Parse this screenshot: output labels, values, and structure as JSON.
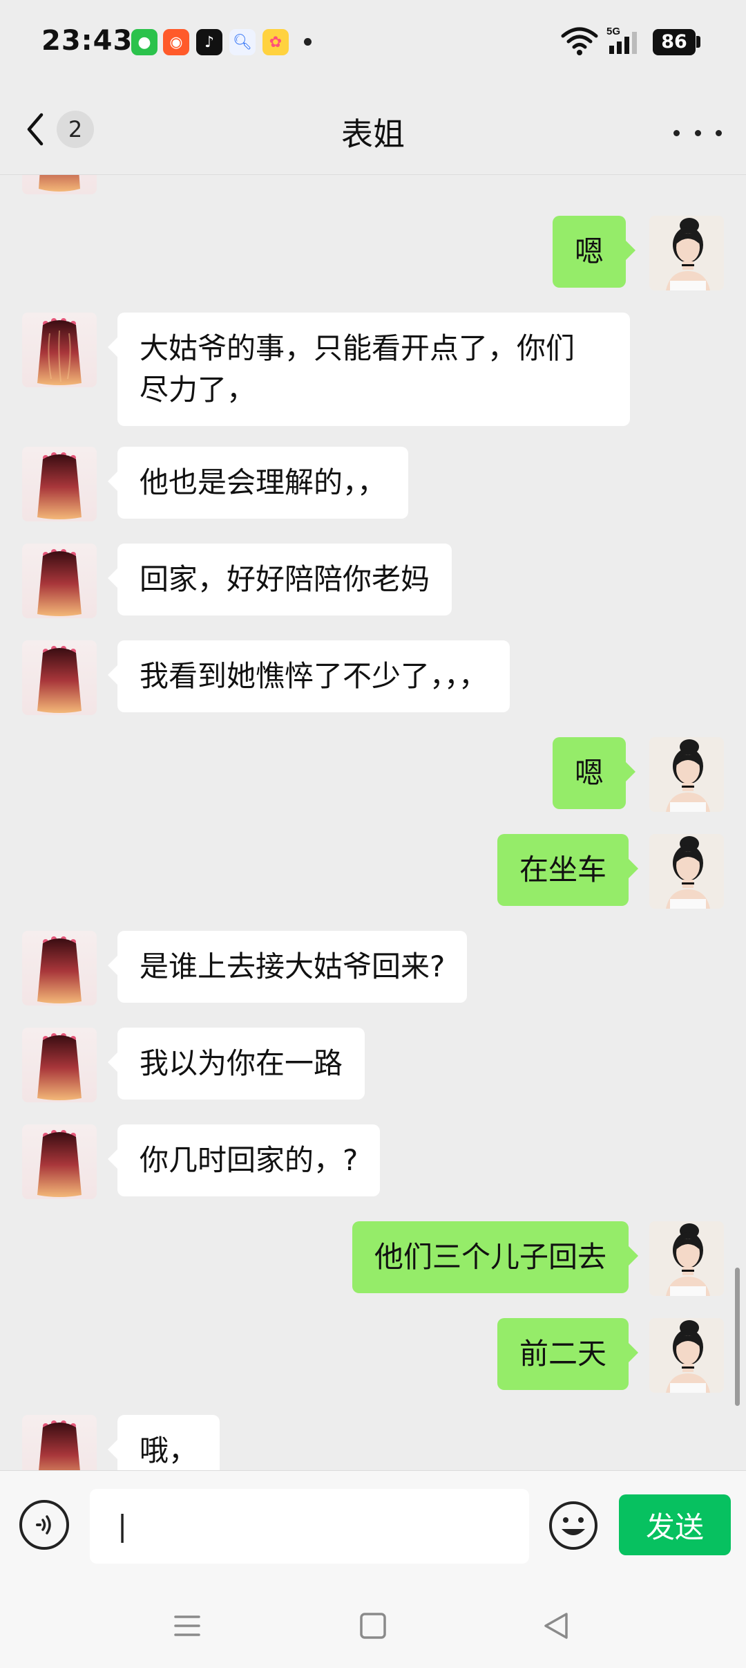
{
  "status_bar": {
    "time": "23:43",
    "battery": "86",
    "network": "5G"
  },
  "header": {
    "title": "表姐",
    "unread_count": "2"
  },
  "messages": [
    {
      "from": "other",
      "text": ""
    },
    {
      "from": "me",
      "text": "嗯"
    },
    {
      "from": "other",
      "text": "大姑爷的事，只能看开点了，你们\n尽力了，"
    },
    {
      "from": "other",
      "text": "他也是会理解的，，"
    },
    {
      "from": "other",
      "text": "回家，好好陪陪你老妈"
    },
    {
      "from": "other",
      "text": "我看到她憔悴了不少了，，，"
    },
    {
      "from": "me",
      "text": "嗯"
    },
    {
      "from": "me",
      "text": "在坐车"
    },
    {
      "from": "other",
      "text": "是谁上去接大姑爷回来?"
    },
    {
      "from": "other",
      "text": "我以为你在一路"
    },
    {
      "from": "other",
      "text": "你几时回家的，?"
    },
    {
      "from": "me",
      "text": "他们三个儿子回去"
    },
    {
      "from": "me",
      "text": "前二天"
    },
    {
      "from": "other",
      "text": "哦，"
    }
  ],
  "composer": {
    "value": "|",
    "send_label": "发送"
  },
  "colors": {
    "outgoing_bubble": "#95ec69",
    "send_button": "#07c160",
    "background": "#ededed"
  }
}
